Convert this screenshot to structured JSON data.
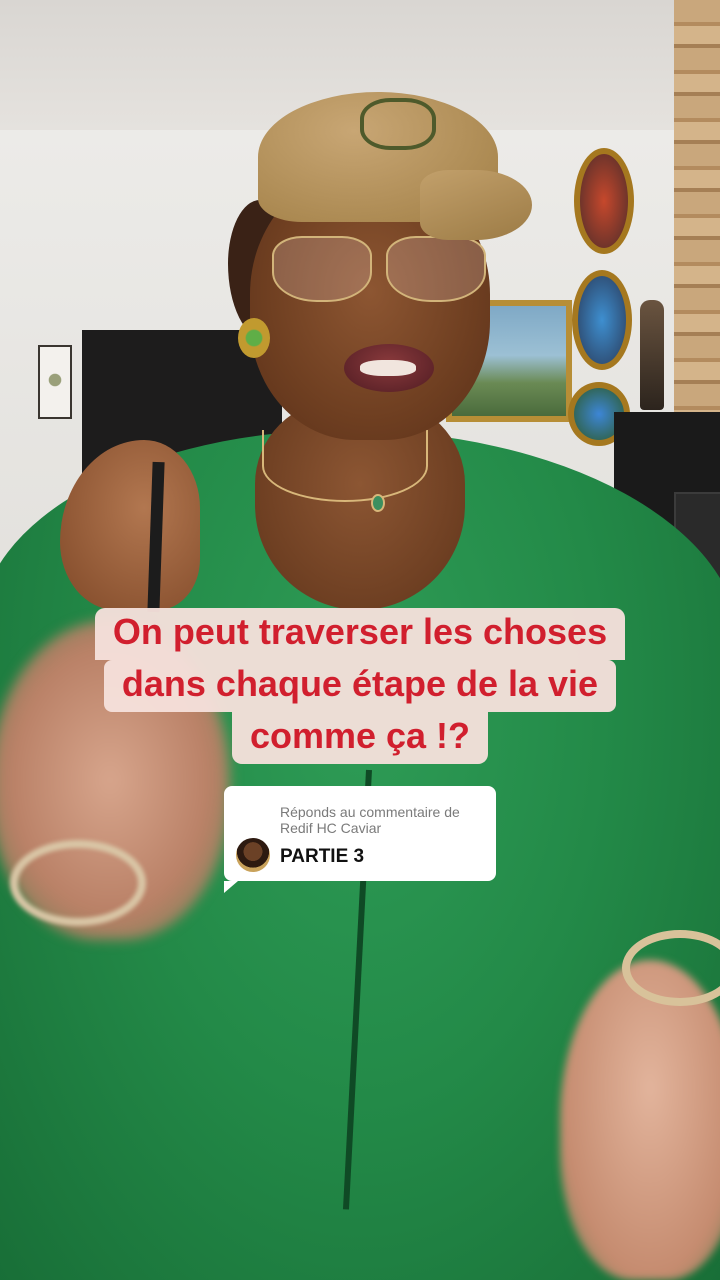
{
  "caption": {
    "line1": "On peut traverser les choses",
    "line2": "dans chaque étape de la vie",
    "line3": "comme ça !?"
  },
  "reply": {
    "prefix": "Réponds au commentaire de",
    "username": "Redif HC Caviar",
    "comment": "PARTIE 3"
  },
  "colors": {
    "caption_text": "#d11f2e",
    "caption_background": "#f5e0db",
    "hoodie": "#238a48"
  }
}
